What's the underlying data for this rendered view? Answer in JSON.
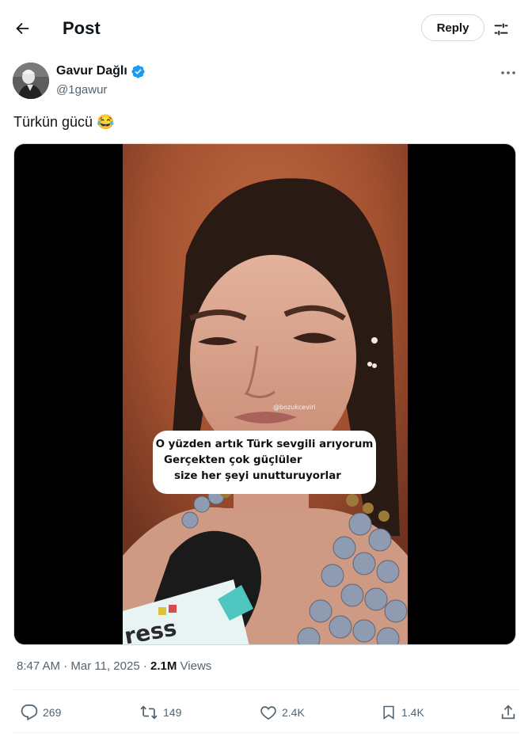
{
  "header": {
    "title": "Post",
    "reply_label": "Reply"
  },
  "author": {
    "name": "Gavur Dağlı",
    "handle": "@1gawur",
    "verified": true
  },
  "post": {
    "text": "Türkün gücü 😂",
    "video_watermark": "@bozukceviri",
    "video_caption": [
      "O yüzden artık Türk sevgili arıyorum",
      "Gerçekten çok güçlüler",
      "size her şeyi unutturuyorlar"
    ],
    "mic_text": "ress"
  },
  "meta": {
    "time": "8:47 AM",
    "date": "Mar 11, 2025",
    "views": "2.1M",
    "views_label": "Views"
  },
  "actions": {
    "replies": "269",
    "reposts": "149",
    "likes": "2.4K",
    "bookmarks": "1.4K"
  },
  "colors": {
    "verified_blue": "#1d9bf0",
    "secondary_text": "#536471"
  },
  "icons": [
    "back-arrow-icon",
    "tune-icon",
    "verified-badge-icon",
    "more-icon",
    "reply-icon",
    "repost-icon",
    "like-icon",
    "bookmark-icon",
    "share-icon"
  ]
}
